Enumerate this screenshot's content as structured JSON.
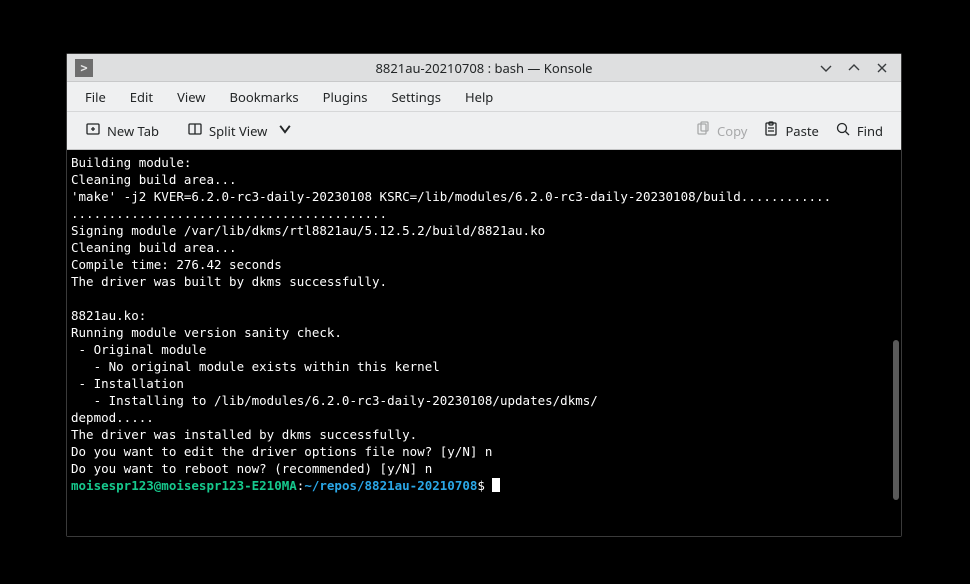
{
  "titlebar": {
    "title": "8821au-20210708 : bash — Konsole"
  },
  "menubar": {
    "items": [
      "File",
      "Edit",
      "View",
      "Bookmarks",
      "Plugins",
      "Settings",
      "Help"
    ]
  },
  "toolbar": {
    "new_tab": "New Tab",
    "split_view": "Split View",
    "copy": "Copy",
    "paste": "Paste",
    "find": "Find"
  },
  "terminal": {
    "lines": [
      "Building module:",
      "Cleaning build area...",
      "'make' -j2 KVER=6.2.0-rc3-daily-20230108 KSRC=/lib/modules/6.2.0-rc3-daily-20230108/build............",
      "..........................................",
      "Signing module /var/lib/dkms/rtl8821au/5.12.5.2/build/8821au.ko",
      "Cleaning build area...",
      "Compile time: 276.42 seconds",
      "The driver was built by dkms successfully.",
      "",
      "8821au.ko:",
      "Running module version sanity check.",
      " - Original module",
      "   - No original module exists within this kernel",
      " - Installation",
      "   - Installing to /lib/modules/6.2.0-rc3-daily-20230108/updates/dkms/",
      "depmod.....",
      "The driver was installed by dkms successfully.",
      "Do you want to edit the driver options file now? [y/N] n",
      "Do you want to reboot now? (recommended) [y/N] n"
    ],
    "prompt": {
      "userhost": "moisespr123@moisespr123-E210MA",
      "colon": ":",
      "path": "~/repos/8821au-20210708",
      "symbol": "$"
    }
  }
}
